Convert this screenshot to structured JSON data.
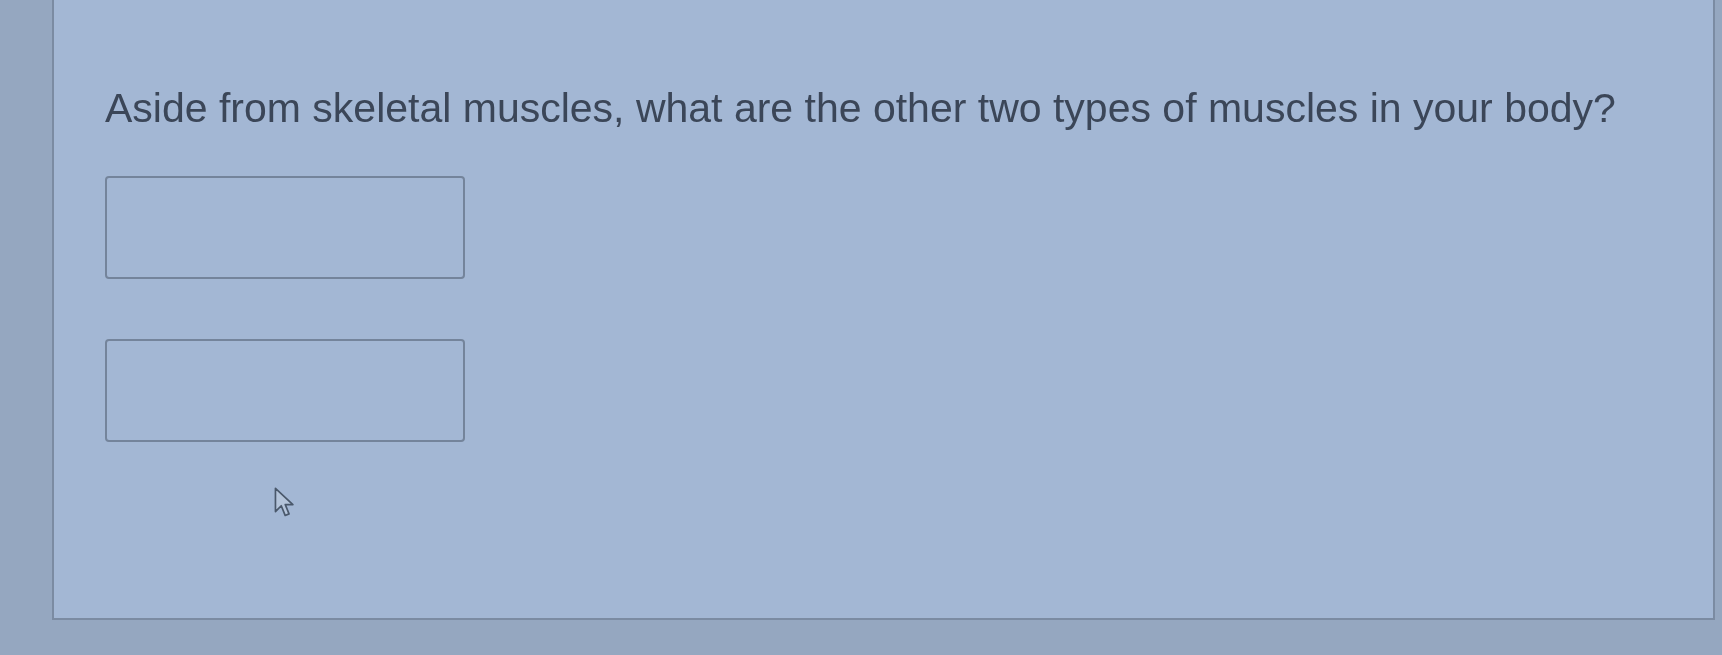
{
  "question": {
    "text": "Aside from skeletal muscles, what are the other two types of muscles in your body?"
  },
  "answer_fields": [
    {
      "kind": "text"
    },
    {
      "kind": "text"
    }
  ]
}
